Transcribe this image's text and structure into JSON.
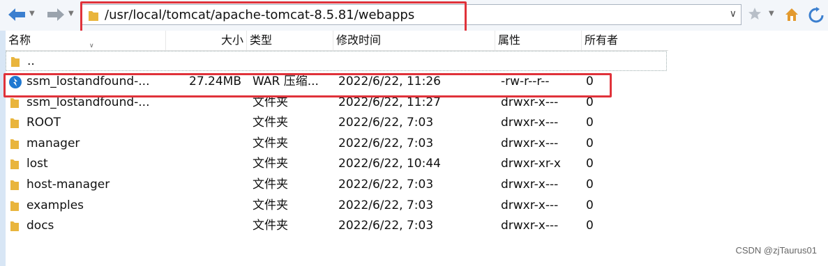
{
  "colors": {
    "highlight": "#e0323a",
    "folder": "#e9b53d",
    "nav_arrow": "#3b7fcf",
    "war_icon": "#1f78d1"
  },
  "toolbar": {
    "back_icon": "arrow-left-icon",
    "forward_icon": "arrow-right-icon",
    "address_path": "/usr/local/tomcat/apache-tomcat-8.5.81/webapps",
    "favorite_icon": "star-icon",
    "home_icon": "home-icon",
    "refresh_icon": "refresh-icon"
  },
  "columns": {
    "name": "名称",
    "size": "大小",
    "type": "类型",
    "modified": "修改时间",
    "attributes": "属性",
    "owner": "所有者"
  },
  "files": [
    {
      "name": "..",
      "size": "",
      "type": "",
      "modified": "",
      "attributes": "",
      "owner": "",
      "icon": "folder-icon"
    },
    {
      "name": "ssm_lostandfound-...",
      "size": "27.24MB",
      "type": "WAR 压缩...",
      "modified": "2022/6/22, 11:26",
      "attributes": "-rw-r--r--",
      "owner": "0",
      "icon": "war-file-icon"
    },
    {
      "name": "ssm_lostandfound-...",
      "size": "",
      "type": "文件夹",
      "modified": "2022/6/22, 11:27",
      "attributes": "drwxr-x---",
      "owner": "0",
      "icon": "folder-icon"
    },
    {
      "name": "ROOT",
      "size": "",
      "type": "文件夹",
      "modified": "2022/6/22, 7:03",
      "attributes": "drwxr-x---",
      "owner": "0",
      "icon": "folder-icon"
    },
    {
      "name": "manager",
      "size": "",
      "type": "文件夹",
      "modified": "2022/6/22, 7:03",
      "attributes": "drwxr-x---",
      "owner": "0",
      "icon": "folder-icon"
    },
    {
      "name": "lost",
      "size": "",
      "type": "文件夹",
      "modified": "2022/6/22, 10:44",
      "attributes": "drwxr-xr-x",
      "owner": "0",
      "icon": "folder-icon"
    },
    {
      "name": "host-manager",
      "size": "",
      "type": "文件夹",
      "modified": "2022/6/22, 7:03",
      "attributes": "drwxr-x---",
      "owner": "0",
      "icon": "folder-icon"
    },
    {
      "name": "examples",
      "size": "",
      "type": "文件夹",
      "modified": "2022/6/22, 7:03",
      "attributes": "drwxr-x---",
      "owner": "0",
      "icon": "folder-icon"
    },
    {
      "name": "docs",
      "size": "",
      "type": "文件夹",
      "modified": "2022/6/22, 7:03",
      "attributes": "drwxr-x---",
      "owner": "0",
      "icon": "folder-icon"
    }
  ],
  "watermark": "CSDN @zjTaurus01"
}
